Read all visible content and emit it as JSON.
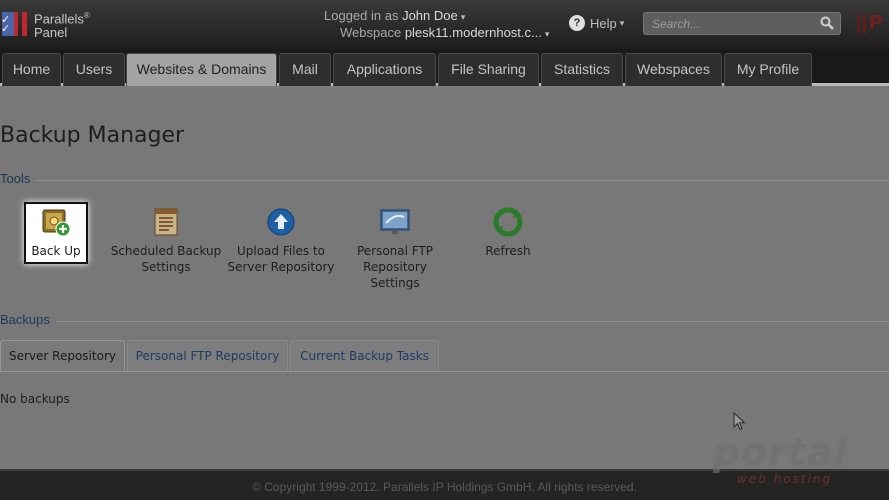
{
  "header": {
    "logo_text": "Parallels",
    "logo_sub": "Panel",
    "logged_in_label": "Logged in as",
    "user_name": "John Doe",
    "webspace_label": "Webspace",
    "webspace_value": "plesk11.modernhost.c...",
    "help_label": "Help",
    "search_placeholder": "Search..."
  },
  "nav": {
    "tabs": [
      {
        "label": "Home"
      },
      {
        "label": "Users"
      },
      {
        "label": "Websites & Domains",
        "active": true
      },
      {
        "label": "Mail"
      },
      {
        "label": "Applications"
      },
      {
        "label": "File Sharing"
      },
      {
        "label": "Statistics"
      },
      {
        "label": "Webspaces"
      },
      {
        "label": "My Profile"
      }
    ]
  },
  "main": {
    "title": "Backup Manager",
    "tools_heading": "Tools",
    "tools": [
      {
        "label": "Back Up",
        "icon": "backup-icon"
      },
      {
        "label": "Scheduled Backup\nSettings",
        "icon": "scheduled-backup-icon"
      },
      {
        "label": "Upload Files to\nServer Repository",
        "icon": "upload-icon"
      },
      {
        "label": "Personal FTP\nRepository\nSettings",
        "icon": "ftp-repository-icon"
      },
      {
        "label": "Refresh",
        "icon": "refresh-icon"
      }
    ],
    "backups_heading": "Backups",
    "backup_tabs": [
      {
        "label": "Server Repository",
        "active": true
      },
      {
        "label": "Personal FTP Repository"
      },
      {
        "label": "Current Backup Tasks"
      }
    ],
    "empty_message": "No backups"
  },
  "footer": {
    "copyright": "© Copyright 1999-2012. Parallels IP Holdings GmbH. All rights reserved."
  },
  "watermark": {
    "line1": "portal",
    "line2": "web hosting"
  },
  "colors": {
    "overlay_gray": "#787878",
    "header_dark": "#1e1e1e",
    "active_tab": "#a3a3a3",
    "section_heading": "#1c3a55"
  }
}
